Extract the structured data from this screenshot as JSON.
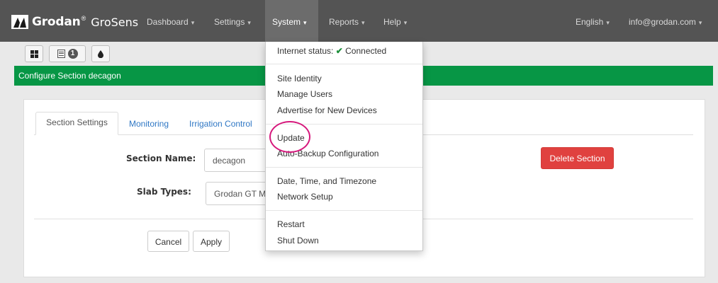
{
  "navbar": {
    "brand": "Grodan",
    "brand_tm": "®",
    "product": "GroSens",
    "items": [
      {
        "label": "Dashboard",
        "caret": "▾"
      },
      {
        "label": "Settings",
        "caret": "▾"
      },
      {
        "label": "System",
        "caret": "▾"
      },
      {
        "label": "Reports",
        "caret": "▾"
      },
      {
        "label": "Help",
        "caret": "▾"
      }
    ],
    "language": {
      "label": "English",
      "caret": "▾"
    },
    "account": {
      "label": "info@grodan.com",
      "caret": "▾"
    }
  },
  "toolbar": {
    "buttons": [
      {
        "icon": "grid-icon"
      },
      {
        "icon": "list-icon",
        "badge": "1"
      },
      {
        "icon": "drop-icon"
      }
    ]
  },
  "header": {
    "title": "Configure Section decagon"
  },
  "tabs": [
    {
      "label": "Section Settings"
    },
    {
      "label": "Monitoring"
    },
    {
      "label": "Irrigation Control"
    }
  ],
  "form": {
    "section_name": {
      "label": "Section Name:",
      "value": "decagon"
    },
    "slab_types": {
      "label": "Slab Types:",
      "value": "Grodan GT M"
    },
    "delete_label": "Delete Section",
    "cancel_label": "Cancel",
    "apply_label": "Apply"
  },
  "system_menu": {
    "status_prefix": "Internet status:",
    "status_check": "✔",
    "status_value": "Connected",
    "groups": [
      [
        "Site Identity",
        "Manage Users",
        "Advertise for New Devices"
      ],
      [
        "Update",
        "Auto-Backup Configuration"
      ],
      [
        "Date, Time, and Timezone",
        "Network Setup"
      ],
      [
        "Restart",
        "Shut Down"
      ]
    ]
  },
  "colors": {
    "navbar": "#545454",
    "header_green": "#079645",
    "danger": "#e0413f",
    "link": "#2f77c4",
    "highlight": "#d6187c"
  }
}
